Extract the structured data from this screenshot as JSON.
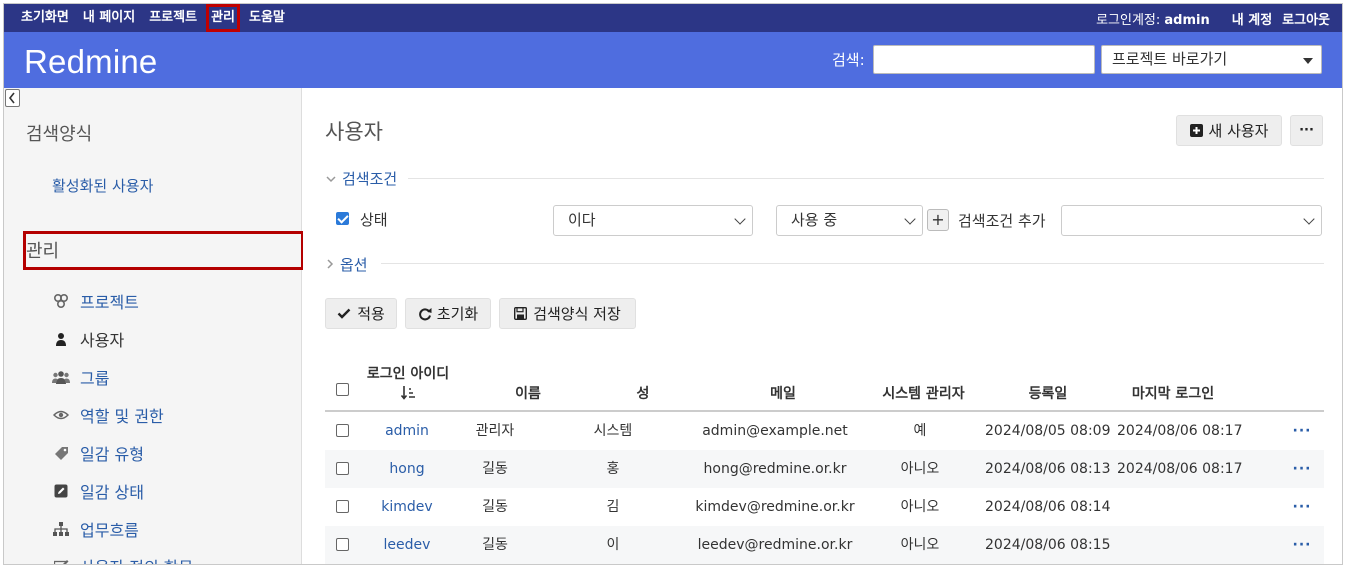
{
  "top_menu": {
    "items": [
      "초기화면",
      "내 페이지",
      "프로젝트",
      "관리",
      "도움말"
    ],
    "account_label": "로그인계정:",
    "account_user": "admin",
    "my_account": "내 계정",
    "logout": "로그아웃"
  },
  "header": {
    "title": "Redmine",
    "search_label": "검색:",
    "search_value": "",
    "project_jump": "프로젝트 바로가기"
  },
  "sidebar": {
    "queries_heading": "검색양식",
    "active_users_link": "활성화된 사용자",
    "admin_heading": "관리",
    "items": [
      {
        "label": "프로젝트",
        "icon": "projects-icon"
      },
      {
        "label": "사용자",
        "icon": "user-icon"
      },
      {
        "label": "그룹",
        "icon": "group-icon"
      },
      {
        "label": "역할 및 권한",
        "icon": "eye-icon"
      },
      {
        "label": "일감 유형",
        "icon": "tag-icon"
      },
      {
        "label": "일감 상태",
        "icon": "edit-icon"
      },
      {
        "label": "업무흐름",
        "icon": "workflow-icon"
      },
      {
        "label": "사용자 정의 항목",
        "icon": "custom-fields-icon"
      }
    ],
    "selected_index": 1
  },
  "main": {
    "page_title": "사용자",
    "new_user_button": "새 사용자",
    "more_button": "···",
    "filters_legend": "검색조건",
    "filter_status_label": "상태",
    "filter_operator": "이다",
    "filter_value": "사용 중",
    "add_filter_label": "검색조건 추가",
    "add_filter_value": "",
    "options_legend": "옵션",
    "apply_button": "적용",
    "reset_button": "초기화",
    "save_query_button": "검색양식 저장"
  },
  "table": {
    "columns": [
      "로그인 아이디",
      "이름",
      "성",
      "메일",
      "시스템 관리자",
      "등록일",
      "마지막 로그인"
    ],
    "sort_icon": "sort-asc-icon",
    "rows": [
      {
        "login": "admin",
        "firstname": "관리자",
        "lastname": "시스템",
        "mail": "admin@example.net",
        "admin": "예",
        "created": "2024/08/05 08:09",
        "last_login": "2024/08/06 08:17"
      },
      {
        "login": "hong",
        "firstname": "길동",
        "lastname": "홍",
        "mail": "hong@redmine.or.kr",
        "admin": "아니오",
        "created": "2024/08/06 08:13",
        "last_login": "2024/08/06 08:17"
      },
      {
        "login": "kimdev",
        "firstname": "길동",
        "lastname": "김",
        "mail": "kimdev@redmine.or.kr",
        "admin": "아니오",
        "created": "2024/08/06 08:14",
        "last_login": ""
      },
      {
        "login": "leedev",
        "firstname": "길동",
        "lastname": "이",
        "mail": "leedev@redmine.or.kr",
        "admin": "아니오",
        "created": "2024/08/06 08:15",
        "last_login": ""
      }
    ],
    "row_actions": "···"
  },
  "colors": {
    "top_menu_bg": "#2c3686",
    "header_bg": "#4f6ddf",
    "highlight": "#c00000",
    "link": "#2a5da8"
  }
}
